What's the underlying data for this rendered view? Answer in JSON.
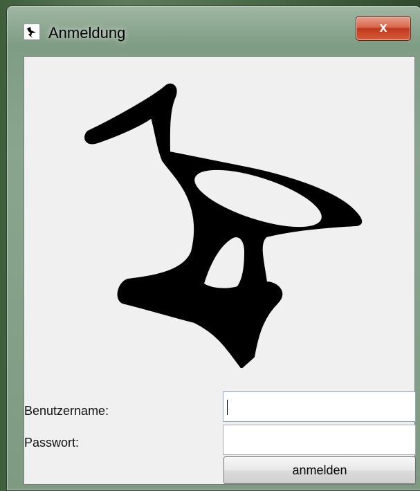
{
  "window": {
    "title": "Anmeldung",
    "close_label": "x"
  },
  "logo": {
    "icon": "ibis-bird-logo"
  },
  "form": {
    "username_label": "Benutzername:",
    "username_value": "",
    "password_label": "Passwort:",
    "password_value": "",
    "login_label": "anmelden"
  }
}
